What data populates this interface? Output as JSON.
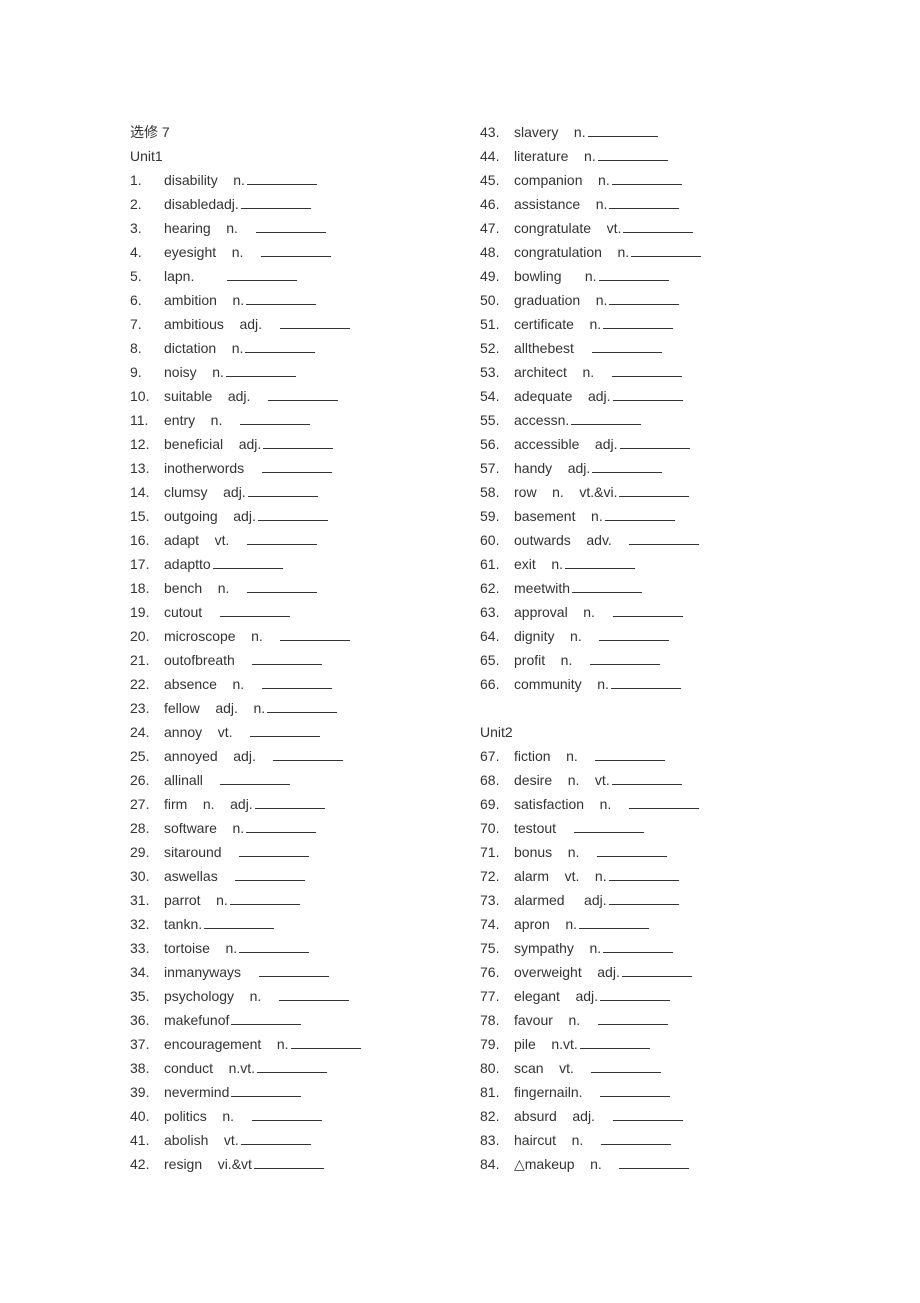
{
  "title": "选修 7",
  "unit1_label": "Unit1",
  "unit2_label": "Unit2",
  "col1": [
    {
      "n": "1.",
      "t": "disability    n."
    },
    {
      "n": "2.",
      "t": "disabledadj."
    },
    {
      "n": "3.",
      "t": "hearing    n.    "
    },
    {
      "n": "4.",
      "t": "eyesight    n.    "
    },
    {
      "n": "5.",
      "t": "lapn.        "
    },
    {
      "n": "6.",
      "t": "ambition    n."
    },
    {
      "n": "7.",
      "t": "ambitious    adj.    "
    },
    {
      "n": "8.",
      "t": "dictation    n."
    },
    {
      "n": "9.",
      "t": "noisy    n."
    },
    {
      "n": "10.",
      "t": "suitable    adj.    "
    },
    {
      "n": "11.",
      "t": "entry    n.    "
    },
    {
      "n": "12.",
      "t": "beneficial    adj."
    },
    {
      "n": "13.",
      "t": "inotherwords    "
    },
    {
      "n": "14.",
      "t": "clumsy    adj."
    },
    {
      "n": "15.",
      "t": "outgoing    adj."
    },
    {
      "n": "16.",
      "t": "adapt    vt.    "
    },
    {
      "n": "17.",
      "t": "adaptto"
    },
    {
      "n": "18.",
      "t": "bench    n.    "
    },
    {
      "n": "19.",
      "t": "cutout    "
    },
    {
      "n": "20.",
      "t": "microscope    n.    "
    },
    {
      "n": "21.",
      "t": "outofbreath    "
    },
    {
      "n": "22.",
      "t": "absence    n.    "
    },
    {
      "n": "23.",
      "t": "fellow    adj.    n."
    },
    {
      "n": "24.",
      "t": "annoy    vt.    "
    },
    {
      "n": "25.",
      "t": "annoyed    adj.    "
    },
    {
      "n": "26.",
      "t": "allinall    "
    },
    {
      "n": "27.",
      "t": "firm    n.    adj."
    },
    {
      "n": "28.",
      "t": "software    n."
    },
    {
      "n": "29.",
      "t": "sitaround    "
    },
    {
      "n": "30.",
      "t": "aswellas    "
    },
    {
      "n": "31.",
      "t": "parrot    n."
    },
    {
      "n": "32.",
      "t": "tankn."
    },
    {
      "n": "33.",
      "t": "tortoise    n."
    },
    {
      "n": "34.",
      "t": "inmanyways    "
    },
    {
      "n": "35.",
      "t": "psychology    n.    "
    },
    {
      "n": "36.",
      "t": "makefunof"
    },
    {
      "n": "37.",
      "t": "encouragement    n."
    },
    {
      "n": "38.",
      "t": "conduct    n.vt."
    },
    {
      "n": "39.",
      "t": "nevermind"
    },
    {
      "n": "40.",
      "t": "politics    n.    "
    },
    {
      "n": "41.",
      "t": "abolish    vt."
    },
    {
      "n": "42.",
      "t": "resign    vi.&vt"
    }
  ],
  "col2a": [
    {
      "n": "43.",
      "t": "slavery    n."
    },
    {
      "n": "44.",
      "t": "literature    n."
    },
    {
      "n": "45.",
      "t": "companion    n."
    },
    {
      "n": "46.",
      "t": "assistance    n."
    },
    {
      "n": "47.",
      "t": "congratulate    vt."
    },
    {
      "n": "48.",
      "t": "congratulation    n."
    },
    {
      "n": "49.",
      "t": "bowling      n."
    },
    {
      "n": "50.",
      "t": "graduation    n."
    },
    {
      "n": "51.",
      "t": "certificate    n."
    },
    {
      "n": "52.",
      "t": "allthebest    "
    },
    {
      "n": "53.",
      "t": "architect    n.    "
    },
    {
      "n": "54.",
      "t": "adequate    adj."
    },
    {
      "n": "55.",
      "t": "accessn."
    },
    {
      "n": "56.",
      "t": "accessible    adj."
    },
    {
      "n": "57.",
      "t": "handy    adj."
    },
    {
      "n": "58.",
      "t": "row    n.    vt.&vi."
    },
    {
      "n": "59.",
      "t": "basement    n."
    },
    {
      "n": "60.",
      "t": "outwards    adv.    "
    },
    {
      "n": "61.",
      "t": "exit    n."
    },
    {
      "n": "62.",
      "t": "meetwith"
    },
    {
      "n": "63.",
      "t": "approval    n.    "
    },
    {
      "n": "64.",
      "t": "dignity    n.    "
    },
    {
      "n": "65.",
      "t": "profit    n.    "
    },
    {
      "n": "66.",
      "t": "community    n."
    }
  ],
  "col2b": [
    {
      "n": "67.",
      "t": "fiction    n.    "
    },
    {
      "n": "68.",
      "t": "desire    n.    vt."
    },
    {
      "n": "69.",
      "t": "satisfaction    n.    "
    },
    {
      "n": "70.",
      "t": "testout    "
    },
    {
      "n": "71.",
      "t": "bonus    n.    "
    },
    {
      "n": "72.",
      "t": "alarm    vt.    n."
    },
    {
      "n": "73.",
      "t": "alarmed     adj."
    },
    {
      "n": "74.",
      "t": "apron    n."
    },
    {
      "n": "75.",
      "t": "sympathy    n."
    },
    {
      "n": "76.",
      "t": "overweight    adj."
    },
    {
      "n": "77.",
      "t": "elegant    adj."
    },
    {
      "n": "78.",
      "t": "favour    n.    "
    },
    {
      "n": "79.",
      "t": "pile    n.vt."
    },
    {
      "n": "80.",
      "t": "scan    vt.    "
    },
    {
      "n": "81.",
      "t": "fingernailn.    "
    },
    {
      "n": "82.",
      "t": "absurd    adj.    "
    },
    {
      "n": "83.",
      "t": "haircut    n.    "
    },
    {
      "n": "84.",
      "t": "△makeup    n.    "
    }
  ]
}
